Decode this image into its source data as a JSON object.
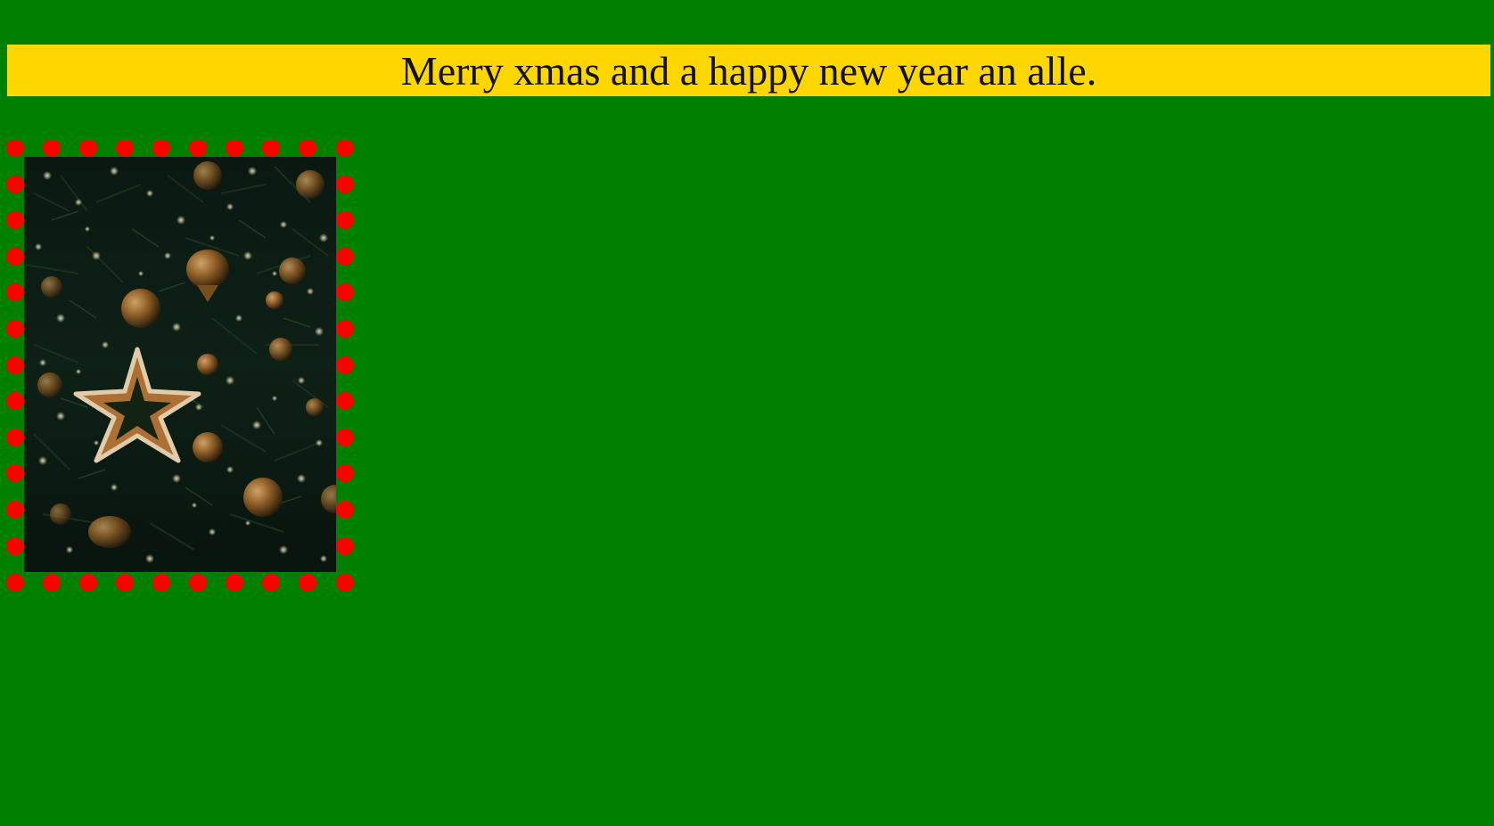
{
  "page": {
    "background_color": "#008000"
  },
  "header": {
    "greeting": "Merry xmas and a happy new year an alle.",
    "background_color": "#ffd700",
    "text_color": "#111111"
  },
  "photo": {
    "subject": "christmas-tree-star-ornaments",
    "border_style": "dotted",
    "border_color": "#ff0000"
  }
}
